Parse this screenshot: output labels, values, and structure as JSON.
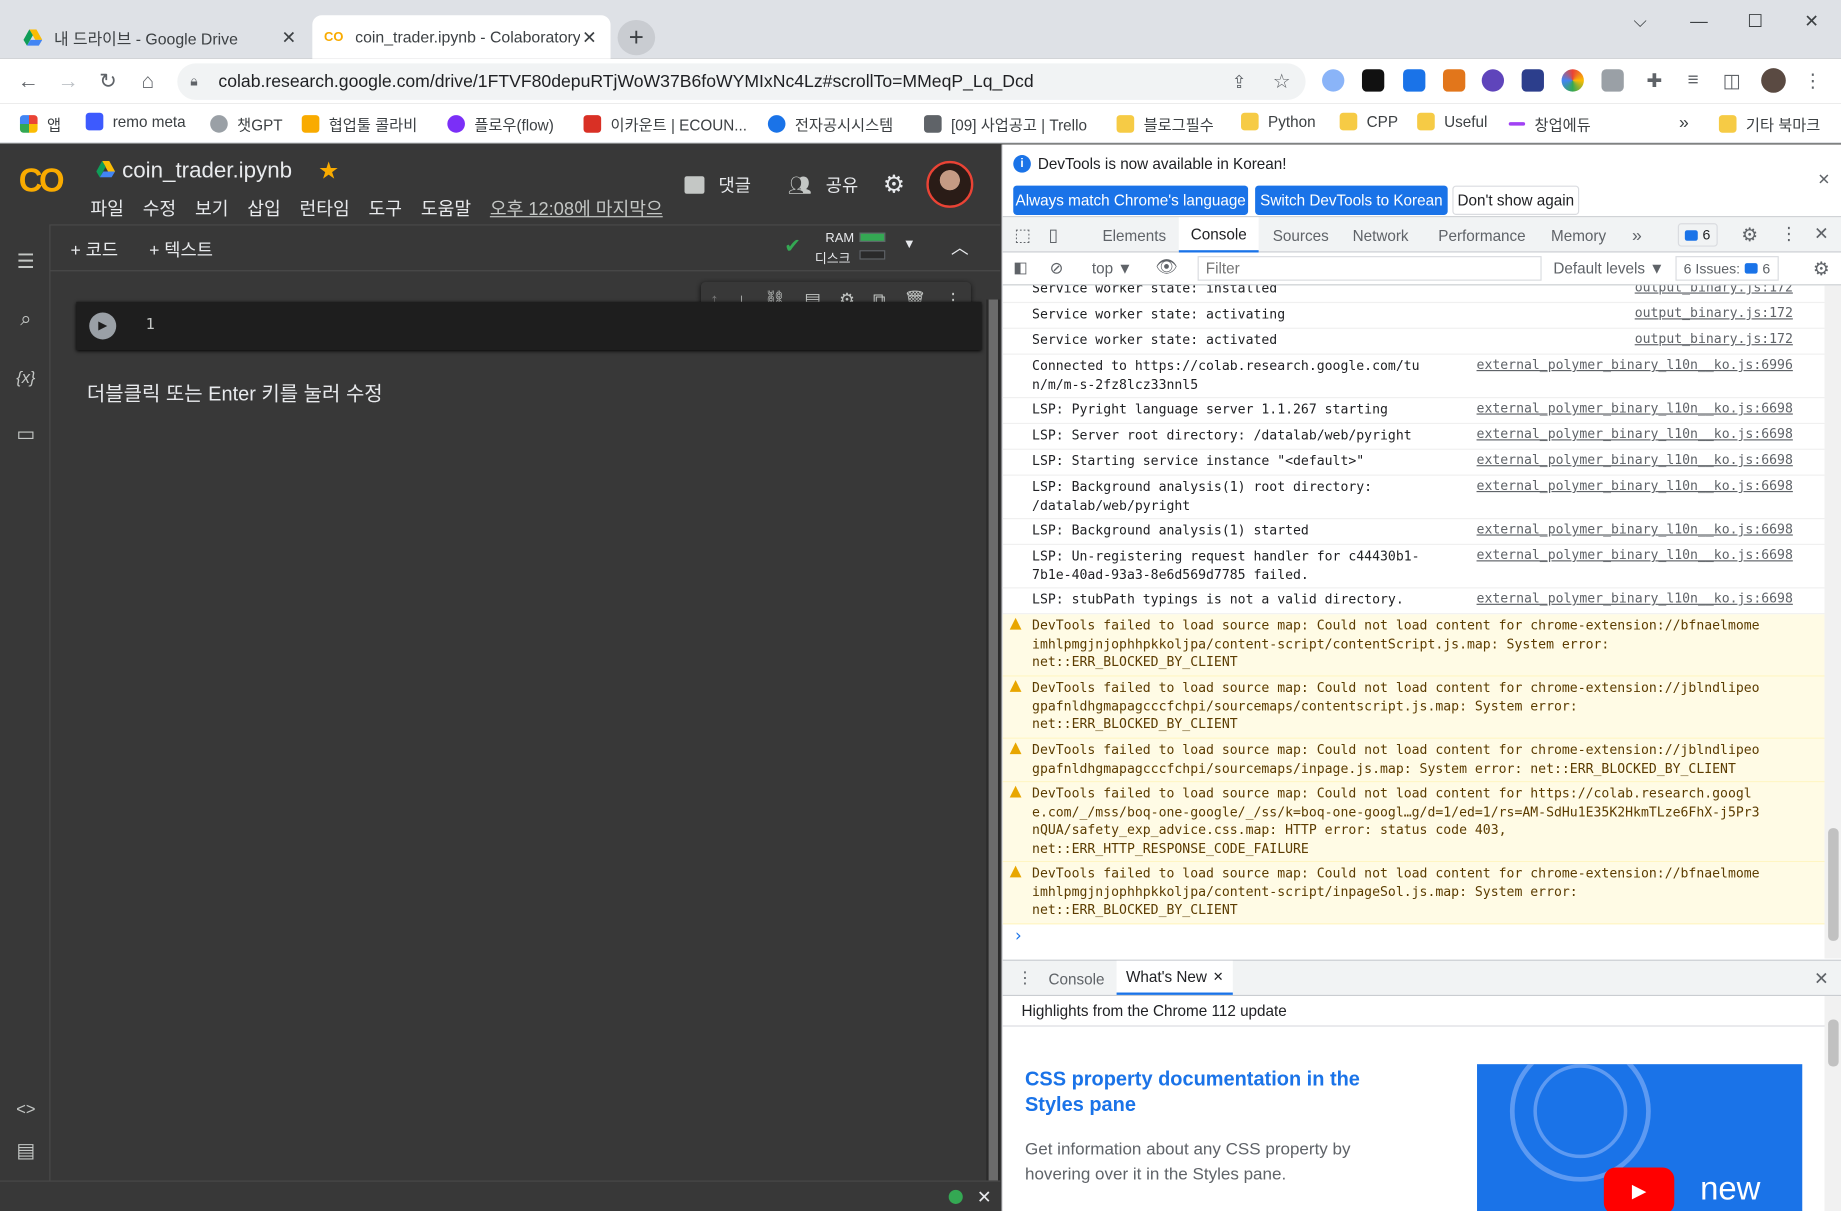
{
  "browser": {
    "tabs": [
      {
        "title": "내 드라이브 - Google Drive",
        "close": "✕"
      },
      {
        "title": "coin_trader.ipynb - Colaboratory",
        "close": "✕"
      }
    ],
    "newtab": "+",
    "window_controls": [
      "⌵",
      "—",
      "☐",
      "✕"
    ],
    "url": "colab.research.google.com/drive/1FTVF80depuRTjWoW37B6foWYMIxNc4Lz#scrollTo=MMeqP_Lq_Dcd",
    "bookmarks": [
      "앱",
      "remo meta",
      "챗GPT",
      "협업툴 콜라비",
      "플로우(flow)",
      "이카운트 | ECOUN...",
      "전자공시시스템",
      "[09] 사업공고 | Trello",
      "블로그필수",
      "Python",
      "CPP",
      "Useful",
      "창업에듀",
      "»",
      "기타 북마크"
    ]
  },
  "colab": {
    "logo": "CO",
    "title": "coin_trader.ipynb",
    "star": "★",
    "menus": [
      "파일",
      "수정",
      "보기",
      "삽입",
      "런타임",
      "도구",
      "도움말"
    ],
    "last_edit": "오후 12:08에 마지막으",
    "comment": "댓글",
    "share": "공유",
    "add_code": "+ 코드",
    "add_text": "+ 텍스트",
    "ram": "RAM",
    "disk": "디스크",
    "cell_line": "1",
    "text_cell": "더블클릭 또는 Enter 키를 눌러 수정"
  },
  "devtools": {
    "info": "DevTools is now available in Korean!",
    "btn_match": "Always match Chrome's language",
    "btn_switch": "Switch DevTools to Korean",
    "btn_dont": "Don't show again",
    "tabs": [
      "Elements",
      "Console",
      "Sources",
      "Network",
      "Performance",
      "Memory",
      "»"
    ],
    "msg_count": "6",
    "context": "top ▼",
    "filter_placeholder": "Filter",
    "levels": "Default levels ▼",
    "issues": "6 Issues:",
    "issues_count": "6",
    "logs": [
      {
        "msg": "Service worker state: installed",
        "src": "output_binary.js:172"
      },
      {
        "msg": "Service worker state: activating",
        "src": "output_binary.js:172"
      },
      {
        "msg": "Service worker state: activated",
        "src": "output_binary.js:172"
      },
      {
        "msg": "Connected to https://colab.research.google.com/tu\nn/m/m-s-2fz8lcz33nnl5",
        "src": "external_polymer_binary_l10n__ko.js:6996"
      },
      {
        "msg": "LSP: Pyright language server 1.1.267 starting",
        "src": "external_polymer_binary_l10n__ko.js:6698"
      },
      {
        "msg": "LSP: Server root directory: /datalab/web/pyright",
        "src": "external_polymer_binary_l10n__ko.js:6698"
      },
      {
        "msg": "LSP: Starting service instance \"<default>\"",
        "src": "external_polymer_binary_l10n__ko.js:6698"
      },
      {
        "msg": "LSP: Background analysis(1) root directory:\n/datalab/web/pyright",
        "src": "external_polymer_binary_l10n__ko.js:6698"
      },
      {
        "msg": "LSP: Background analysis(1) started",
        "src": "external_polymer_binary_l10n__ko.js:6698"
      },
      {
        "msg": "LSP: Un-registering request handler for c44430b1-\n7b1e-40ad-93a3-8e6d569d7785 failed.",
        "src": "external_polymer_binary_l10n__ko.js:6698"
      },
      {
        "msg": "LSP: stubPath typings is not a valid directory.",
        "src": "external_polymer_binary_l10n__ko.js:6698"
      }
    ],
    "warnings": [
      "DevTools failed to load source map: Could not load content for chrome-extension://bfnaelmome\nimhlpmgjnjophhpkkoljpa/content-script/contentScript.js.map: System error:\nnet::ERR_BLOCKED_BY_CLIENT",
      "DevTools failed to load source map: Could not load content for chrome-extension://jblndlipeo\ngpafnldhgmapagcccfchpi/sourcemaps/contentscript.js.map: System error:\nnet::ERR_BLOCKED_BY_CLIENT",
      "DevTools failed to load source map: Could not load content for chrome-extension://jblndlipeo\ngpafnldhgmapagcccfchpi/sourcemaps/inpage.js.map: System error: net::ERR_BLOCKED_BY_CLIENT",
      "DevTools failed to load source map: Could not load content for https://colab.research.googl\ne.com/_/mss/boq-one-google/_/ss/k=boq-one-googl…g/d=1/ed=1/rs=AM-SdHu1E35K2HkmTLze6FhX-j5Pr3\nnQUA/safety_exp_advice.css.map: HTTP error: status code 403,\nnet::ERR_HTTP_RESPONSE_CODE_FAILURE",
      "DevTools failed to load source map: Could not load content for chrome-extension://bfnaelmome\nimhlpmgjnjophhpkkoljpa/content-script/inpageSol.js.map: System error:\nnet::ERR_BLOCKED_BY_CLIENT"
    ],
    "prompt": "›",
    "drawer_tabs": [
      "Console",
      "What's New"
    ],
    "highlights": "Highlights from the Chrome 112 update",
    "feature_title": "CSS property documentation in the Styles pane",
    "feature_desc": "Get information about any CSS property by hovering over it in the Styles pane.",
    "new_badge": "new"
  }
}
